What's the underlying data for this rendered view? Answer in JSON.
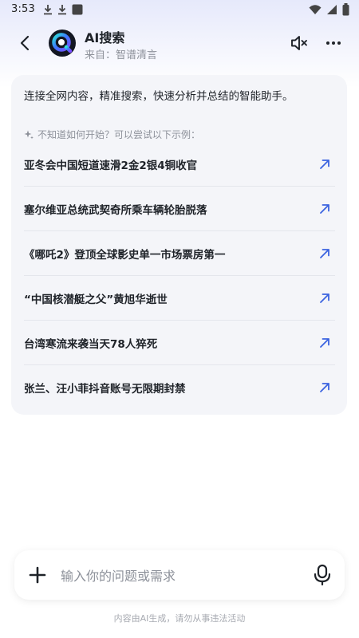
{
  "status_bar": {
    "time": "3:53",
    "left_icons": [
      "download-icon",
      "download-icon",
      "app-square-icon"
    ],
    "right_icons": [
      "wifi-icon",
      "signal-icon",
      "battery-icon"
    ]
  },
  "header": {
    "title": "AI搜索",
    "subtitle": "来自：智谱清言",
    "icons": [
      "back-arrow-icon",
      "ai-search-avatar",
      "speaker-mute-icon",
      "more-icon"
    ]
  },
  "card": {
    "intro": "连接全网内容，精准搜索，快速分析并总结的智能助手。",
    "hint": "不知道如何开始？可以尝试以下示例：",
    "examples": [
      {
        "label": "亚冬会中国短道速滑2金2银4铜收官"
      },
      {
        "label": "塞尔维亚总统武契奇所乘车辆轮胎脱落"
      },
      {
        "label": "《哪吒2》登顶全球影史单一市场票房第一"
      },
      {
        "label": "“中国核潜艇之父”黄旭华逝世"
      },
      {
        "label": "台湾寒流来袭当天78人猝死"
      },
      {
        "label": "张兰、汪小菲抖音账号无限期封禁"
      }
    ]
  },
  "input": {
    "placeholder": "输入你的问题或需求",
    "value": ""
  },
  "footer": {
    "disclaimer": "内容由AI生成，请勿从事违法活动"
  },
  "colors": {
    "accent": "#3b63e0",
    "text_primary": "#1f2329",
    "text_secondary": "#8d919a",
    "card_bg": "#f4f5f9"
  }
}
